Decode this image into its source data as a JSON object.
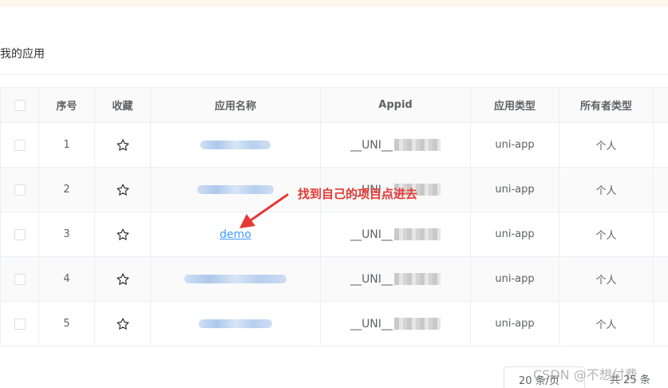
{
  "page": {
    "section_title": "我的应用"
  },
  "table": {
    "headers": [
      "序号",
      "收藏",
      "应用名称",
      "Appid",
      "应用类型",
      "所有者类型"
    ],
    "rows": [
      {
        "index": "1",
        "appid_prefix": "__UNI__",
        "app_type": "uni-app",
        "owner_type": "个人"
      },
      {
        "index": "2",
        "appid_prefix": "__UNI__",
        "app_type": "uni-app",
        "owner_type": "个人"
      },
      {
        "index": "3",
        "app_name": "demo",
        "appid_prefix": "__UNI__",
        "app_type": "uni-app",
        "owner_type": "个人"
      },
      {
        "index": "4",
        "appid_prefix": "__UNI__",
        "app_type": "uni-app",
        "owner_type": "个人"
      },
      {
        "index": "5",
        "appid_prefix": "__UNI__",
        "app_type": "uni-app",
        "owner_type": "个人"
      }
    ]
  },
  "annotation": {
    "text": "找到自己的项目点进去",
    "color": "#e53935"
  },
  "pagination": {
    "page_size": "20 条/页",
    "total": "共 25 条"
  },
  "watermark": "CSDN @不想付费",
  "colors": {
    "link": "#409eff",
    "border": "#ebeef5",
    "stripe": "#fafafa"
  }
}
